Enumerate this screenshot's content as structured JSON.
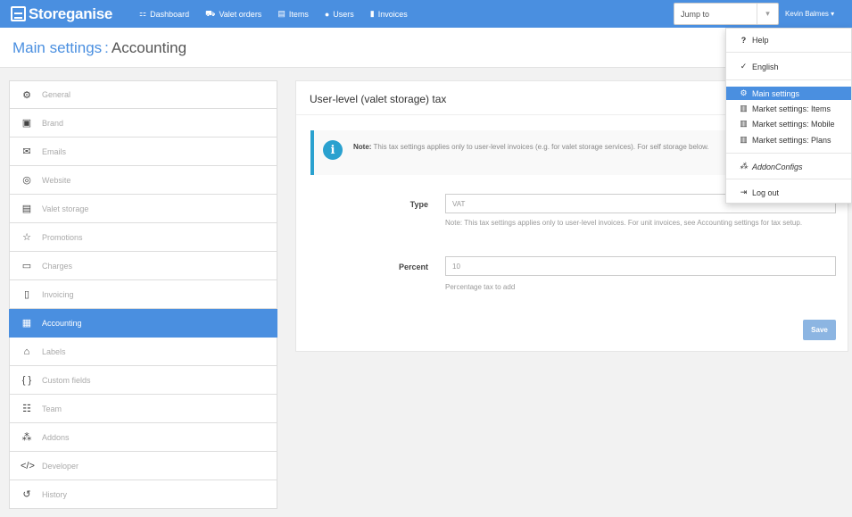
{
  "brand": {
    "name": "Storeganise"
  },
  "nav": [
    {
      "label": "Dashboard",
      "icon": "sitemap-icon"
    },
    {
      "label": "Valet orders",
      "icon": "truck-icon"
    },
    {
      "label": "Items",
      "icon": "box-icon"
    },
    {
      "label": "Users",
      "icon": "user-icon"
    },
    {
      "label": "Invoices",
      "icon": "file-icon"
    }
  ],
  "jump": {
    "label": "Jump to",
    "caret": "▾"
  },
  "user": {
    "label": "Kevin Balmes ▾"
  },
  "breadcrumb": {
    "parent": "Main settings",
    "separator": ":",
    "current": "Accounting"
  },
  "sidebar": [
    {
      "label": "General",
      "icon": "⚙"
    },
    {
      "label": "Brand",
      "icon": "▣"
    },
    {
      "label": "Emails",
      "icon": "✉"
    },
    {
      "label": "Website",
      "icon": "◎"
    },
    {
      "label": "Valet storage",
      "icon": "▤"
    },
    {
      "label": "Promotions",
      "icon": "☆"
    },
    {
      "label": "Charges",
      "icon": "▭"
    },
    {
      "label": "Invoicing",
      "icon": "▯"
    },
    {
      "label": "Accounting",
      "icon": "▦"
    },
    {
      "label": "Labels",
      "icon": "⌂"
    },
    {
      "label": "Custom fields",
      "icon": "{ }"
    },
    {
      "label": "Team",
      "icon": "☷"
    },
    {
      "label": "Addons",
      "icon": "⁂"
    },
    {
      "label": "Developer",
      "icon": "</>"
    },
    {
      "label": "History",
      "icon": "↺"
    }
  ],
  "panel": {
    "title": "User-level (valet storage) tax",
    "note_label": "Note:",
    "note_text": "This tax settings applies only to user-level invoices (e.g. for valet storage services). For self storage below.",
    "type_label": "Type",
    "type_value": "VAT",
    "type_help": "Note: This tax settings applies only to user-level invoices. For unit invoices, see Accounting settings for tax setup.",
    "percent_label": "Percent",
    "percent_value": "10",
    "percent_help": "Percentage tax to add",
    "save_label": "Save"
  },
  "dropdown": {
    "help": "Help",
    "language": "English",
    "main_settings": "Main settings",
    "market_items": "Market settings: Items",
    "market_mobile": "Market settings: Mobile",
    "market_plans": "Market settings: Plans",
    "addon_configs": "AddonConfigs",
    "logout": "Log out"
  },
  "colors": {
    "accent": "#4a8fe0",
    "info": "#2aa1cf"
  }
}
